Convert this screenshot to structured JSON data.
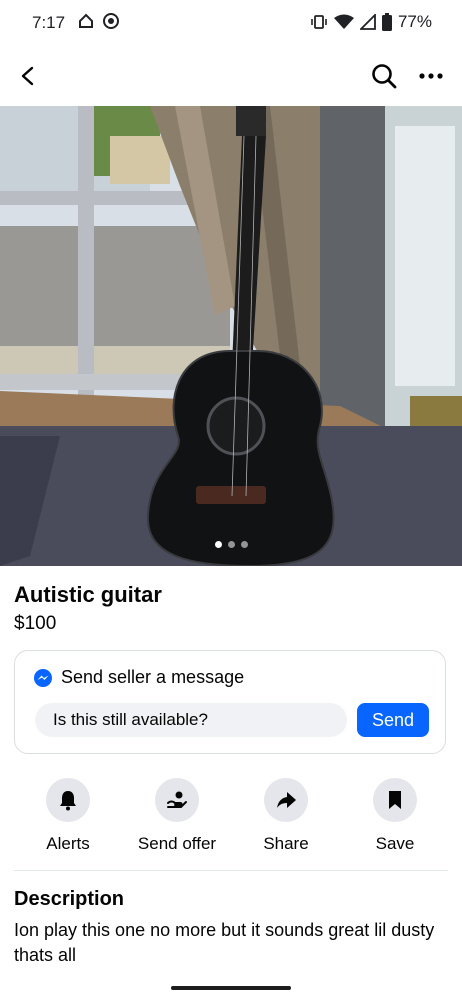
{
  "status_bar": {
    "time": "7:17",
    "battery": "77%"
  },
  "topbar": {
    "back_icon": "chevron-left-icon",
    "search_icon": "search-icon",
    "more_icon": "more-horizontal-icon"
  },
  "photo": {
    "description_icon": "guitar-photo",
    "page_count": 3,
    "current_page": 1
  },
  "listing": {
    "title": "Autistic guitar",
    "price": "$100"
  },
  "message_card": {
    "header": "Send seller a message",
    "input_value": "Is this still available?",
    "send_label": "Send",
    "accent_color": "#0866ff"
  },
  "actions": [
    {
      "label": "Alerts",
      "icon": "bell-icon"
    },
    {
      "label": "Send offer",
      "icon": "offer-icon"
    },
    {
      "label": "Share",
      "icon": "share-icon"
    },
    {
      "label": "Save",
      "icon": "bookmark-icon"
    }
  ],
  "description": {
    "title": "Description",
    "text": "Ion play this one no more but it sounds great lil dusty thats all"
  }
}
